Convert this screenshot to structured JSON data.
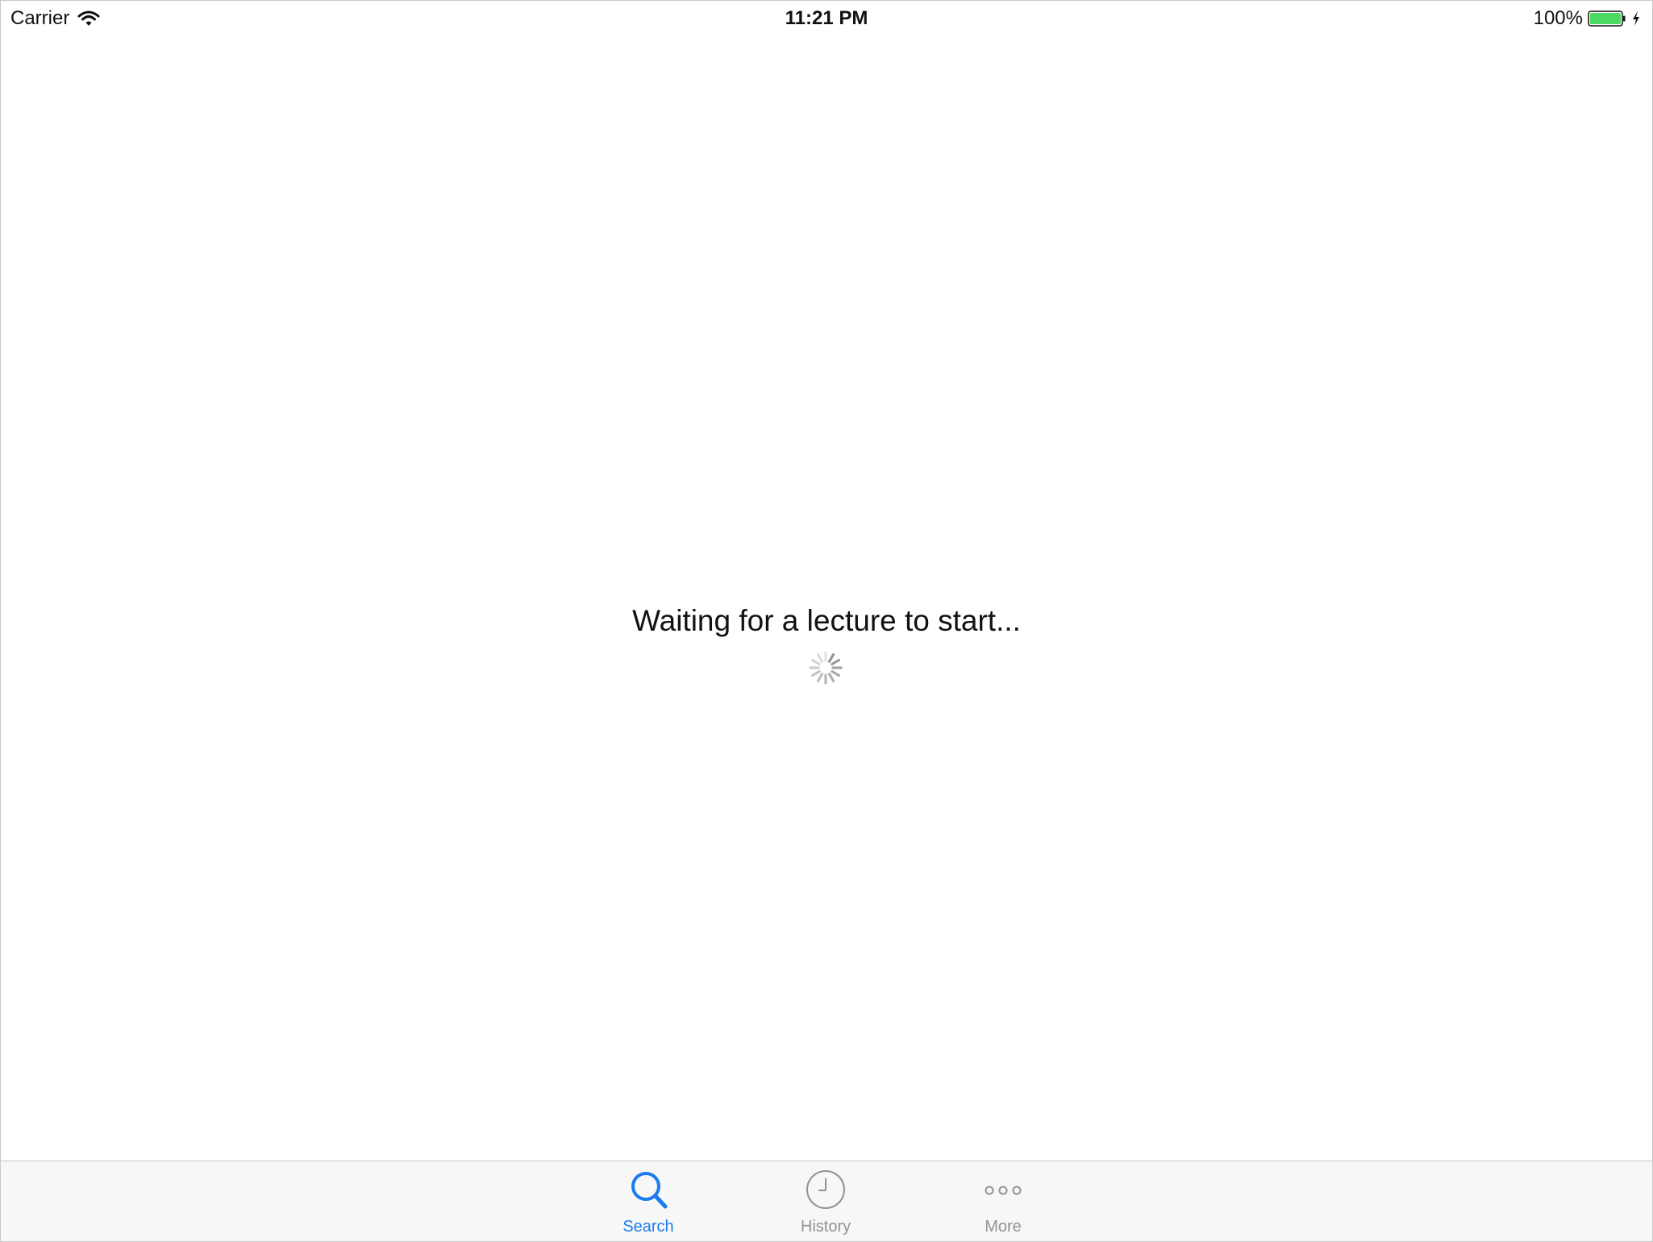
{
  "status_bar": {
    "carrier": "Carrier",
    "time": "11:21 PM",
    "battery": "100%",
    "wifi_icon": "wifi-icon",
    "battery_icon": "battery-full-icon",
    "charging_icon": "bolt-icon"
  },
  "main": {
    "message": "Waiting for a lecture to start...",
    "loading_indicator": "spinner-icon"
  },
  "tab_bar": {
    "active_color": "#1a7cf0",
    "inactive_color": "#929292",
    "tabs": [
      {
        "label": "Search",
        "icon": "search-icon",
        "active": true
      },
      {
        "label": "History",
        "icon": "clock-icon",
        "active": false
      },
      {
        "label": "More",
        "icon": "more-icon",
        "active": false
      }
    ]
  },
  "colors": {
    "battery_fill": "#4cd964",
    "tab_bar_background": "#f7f7f7"
  }
}
